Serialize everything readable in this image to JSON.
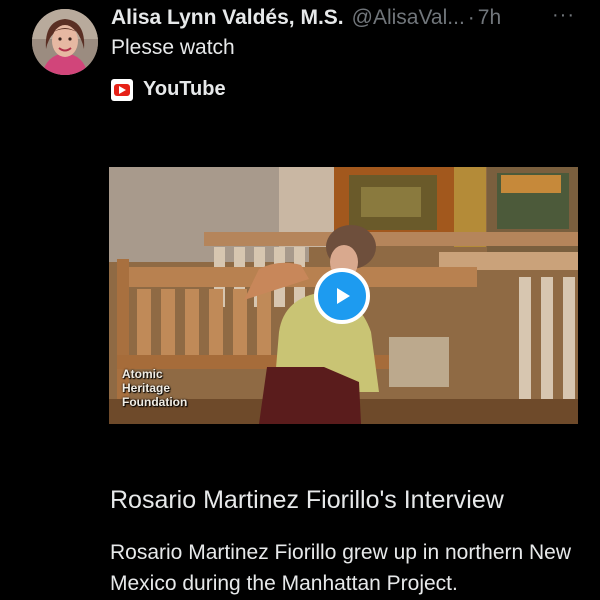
{
  "tweet": {
    "author_name": "Alisa Lynn Valdés, M.S.",
    "author_handle": "@AlisaVal...",
    "separator": "·",
    "time": "7h",
    "more_label": "···",
    "text": "Plesse watch",
    "source_label": "YouTube"
  },
  "card": {
    "watermark_lines": [
      "Atomic",
      "Heritage",
      "Foundation"
    ],
    "title": "Rosario Martinez Fiorillo's Interview",
    "description": "Rosario Martinez Fiorillo grew up in northern New Mexico during the Manhattan Project."
  },
  "colors": {
    "background": "#000000",
    "text": "#e7e9ea",
    "muted": "#71767b",
    "play_button": "#1d9bf0",
    "youtube_red": "#e62117"
  },
  "icons": {
    "avatar": "profile-photo",
    "source": "youtube-icon",
    "play": "play-icon",
    "more": "more-dots-icon"
  }
}
